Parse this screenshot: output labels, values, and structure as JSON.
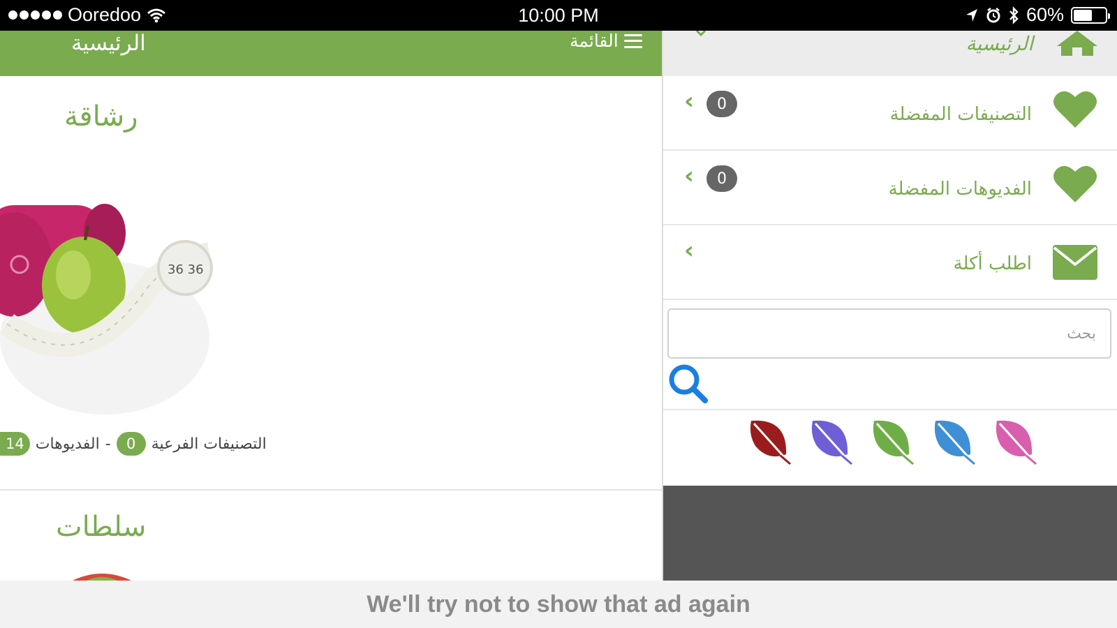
{
  "status_bar": {
    "carrier": "Ooredoo",
    "time": "10:00 PM",
    "battery": "60%",
    "battery_level": 0.6
  },
  "header": {
    "title": "الرئيسية",
    "menu_label": "القائمة"
  },
  "categories": [
    {
      "title": "رشاقة",
      "subcategories_label": "التصنيفات الفرعية",
      "subcategories_count": "0",
      "separator": "-",
      "videos_label": "الفديوهات",
      "videos_count": "14"
    },
    {
      "title": "سلطات"
    }
  ],
  "drawer": {
    "home_label": "الرئيسية",
    "items": [
      {
        "label": "التصنيفات المفضلة",
        "count": "0",
        "icon": "heart-icon"
      },
      {
        "label": "الفديوهات المفضلة",
        "count": "0",
        "icon": "heart-icon"
      },
      {
        "label": "اطلب أكلة",
        "icon": "envelope-icon"
      }
    ],
    "search_placeholder": "بحث",
    "theme_leaves": [
      {
        "name": "dark-red-leaf-icon",
        "color": "#9b1c1c"
      },
      {
        "name": "purple-leaf-icon",
        "color": "#6f5fd6"
      },
      {
        "name": "green-leaf-icon",
        "color": "#6fae47"
      },
      {
        "name": "blue-leaf-icon",
        "color": "#3f8fd6"
      },
      {
        "name": "pink-leaf-icon",
        "color": "#d95fae"
      }
    ]
  },
  "ad_message": "We'll try not to show that ad again",
  "colors": {
    "accent_green": "#7aab4e",
    "drawer_footer": "#555555",
    "search_icon_blue": "#1a7fe0"
  }
}
